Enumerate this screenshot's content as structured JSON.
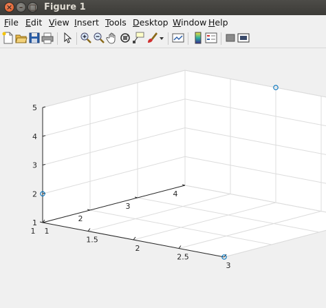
{
  "window": {
    "title": "Figure 1"
  },
  "menu": [
    {
      "label": "File",
      "mnemonic": "F",
      "rest": "ile"
    },
    {
      "label": "Edit",
      "mnemonic": "E",
      "rest": "dit"
    },
    {
      "label": "View",
      "mnemonic": "V",
      "rest": "iew"
    },
    {
      "label": "Insert",
      "mnemonic": "I",
      "rest": "nsert"
    },
    {
      "label": "Tools",
      "mnemonic": "T",
      "rest": "ools"
    },
    {
      "label": "Desktop",
      "mnemonic": "D",
      "rest": "esktop"
    },
    {
      "label": "Window",
      "mnemonic": "W",
      "rest": "indow"
    },
    {
      "label": "Help",
      "mnemonic": "H",
      "rest": "elp"
    }
  ],
  "toolbar": {
    "icons": [
      "new-figure-icon",
      "open-file-icon",
      "save-icon",
      "print-icon",
      "edit-plot-arrow-icon",
      "zoom-in-icon",
      "zoom-out-icon",
      "pan-icon",
      "rotate-3d-icon",
      "data-cursor-icon",
      "brush-icon",
      "brush-dropdown-icon",
      "link-plot-icon",
      "insert-colorbar-icon",
      "insert-legend-icon",
      "hide-plot-tools-icon",
      "show-plot-tools-icon"
    ]
  },
  "chart_data": {
    "type": "scatter",
    "dimensions": "3d",
    "x": [
      1,
      2,
      3
    ],
    "y": [
      1,
      4,
      1
    ],
    "z": [
      2,
      5,
      1
    ],
    "x_ticks": [
      "1",
      "1.5",
      "2",
      "2.5",
      "3"
    ],
    "y_ticks": [
      "1",
      "2",
      "3",
      "4"
    ],
    "z_ticks": [
      "1",
      "2",
      "3",
      "4",
      "5"
    ],
    "xlim": [
      1,
      3
    ],
    "ylim": [
      1,
      4
    ],
    "zlim": [
      1,
      5
    ],
    "grid": true,
    "marker": "circle-open",
    "series_color": "#0072bd",
    "title": "",
    "xlabel": "",
    "ylabel": "",
    "zlabel": ""
  }
}
